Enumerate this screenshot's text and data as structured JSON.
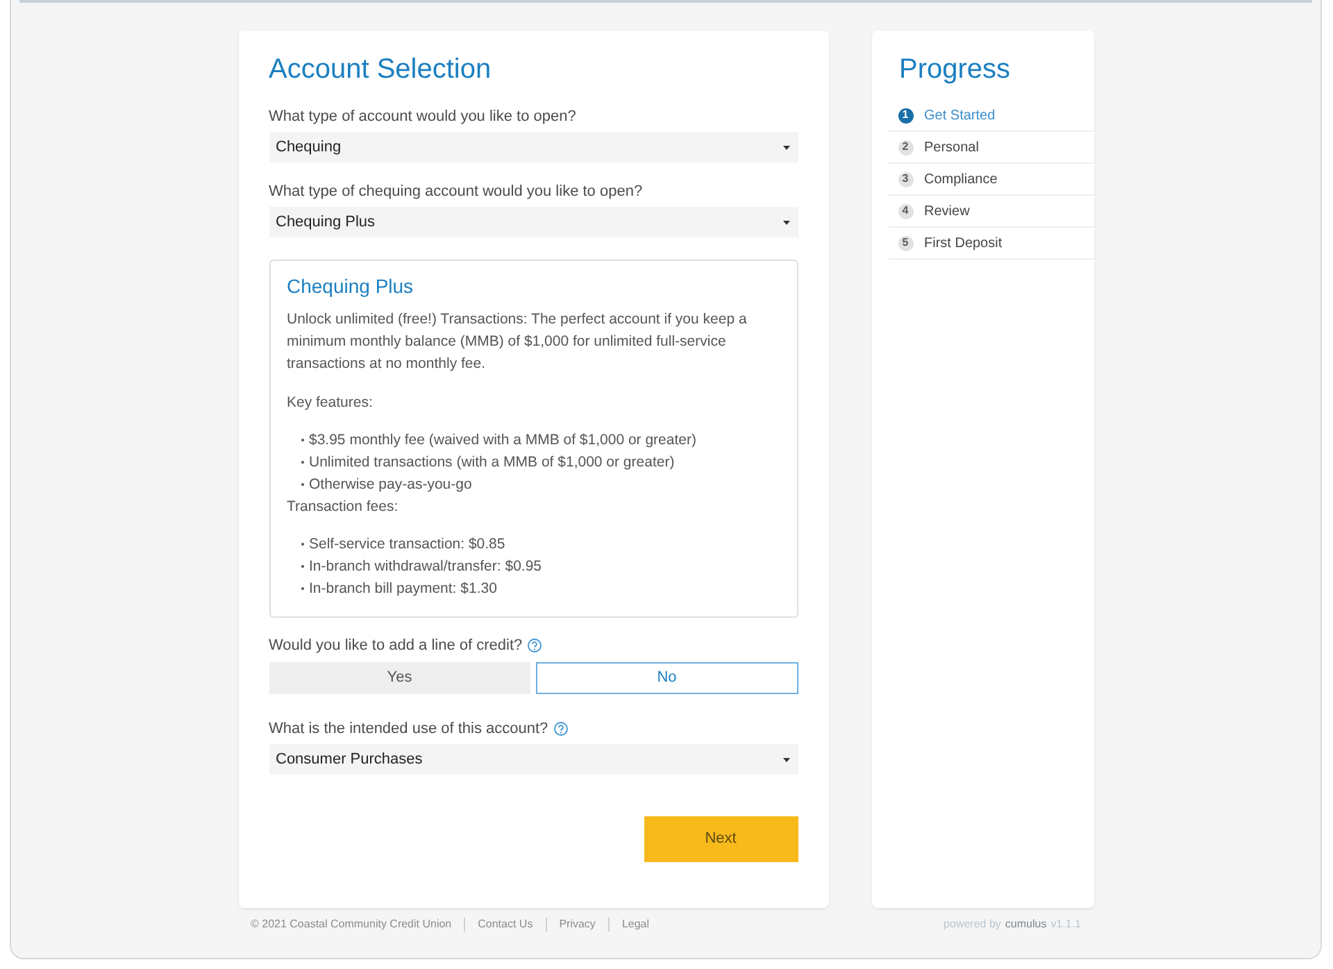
{
  "form": {
    "title": "Account Selection",
    "questions": [
      {
        "kind": "select",
        "label": "What type of account would you like to open?",
        "value": "Chequing"
      },
      {
        "kind": "select",
        "label": "What type of chequing account would you like to open?",
        "value": "Chequing Plus"
      },
      {
        "kind": "details",
        "title": "Chequing Plus",
        "description": "Unlock unlimited (free!) Transactions: The perfect account if you keep a minimum monthly balance (MMB) of $1,000 for unlimited full-service transactions at no monthly fee.",
        "sections": [
          {
            "heading": "Key features:",
            "items": [
              "$3.95 monthly fee (waived with a MMB of $1,000 or greater)",
              "Unlimited transactions (with a MMB of $1,000 or greater)",
              "Otherwise pay-as-you-go"
            ]
          },
          {
            "heading": "Transaction fees:",
            "items": [
              "Self-service transaction: $0.85",
              "In-branch withdrawal/transfer: $0.95",
              "In-branch bill payment: $1.30"
            ]
          }
        ]
      },
      {
        "kind": "toggle",
        "label": "Would you like to add a line of credit?",
        "help": true,
        "options": [
          {
            "label": "Yes",
            "selected": false
          },
          {
            "label": "No",
            "selected": true
          }
        ]
      },
      {
        "kind": "select",
        "label": "What is the intended use of this account?",
        "help": true,
        "value": "Consumer Purchases"
      }
    ],
    "next_button": "Next"
  },
  "progress": {
    "title": "Progress",
    "steps": [
      {
        "number": "1",
        "label": "Get Started",
        "selected": true
      },
      {
        "number": "2",
        "label": "Personal",
        "selected": false
      },
      {
        "number": "3",
        "label": "Compliance",
        "selected": false
      },
      {
        "number": "4",
        "label": "Review",
        "selected": false
      },
      {
        "number": "5",
        "label": "First Deposit",
        "selected": false
      }
    ]
  },
  "footer": {
    "copyright": "© 2021 Coastal Community Credit Union",
    "links": [
      "Contact Us",
      "Privacy",
      "Legal"
    ],
    "powered_by": {
      "prefix": "powered by",
      "brand": "cumulus",
      "version": "v1.1.1"
    }
  }
}
